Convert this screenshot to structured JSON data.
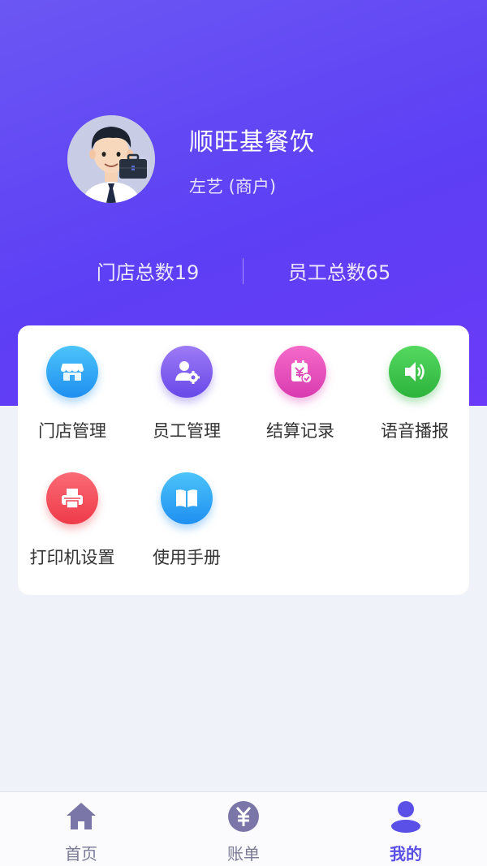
{
  "profile": {
    "shop_name": "顺旺基餐饮",
    "user_line": "左艺 (商户)",
    "avatar_icon": "merchant-avatar"
  },
  "stats": {
    "store_count": "门店总数19",
    "staff_count": "员工总数65"
  },
  "menu": {
    "items": [
      {
        "label": "门店管理",
        "icon": "store-icon"
      },
      {
        "label": "员工管理",
        "icon": "staff-settings-icon"
      },
      {
        "label": "结算记录",
        "icon": "settlement-record-icon"
      },
      {
        "label": "语音播报",
        "icon": "speaker-icon"
      },
      {
        "label": "打印机设置",
        "icon": "printer-icon"
      },
      {
        "label": "使用手册",
        "icon": "manual-book-icon"
      }
    ]
  },
  "tabbar": {
    "items": [
      {
        "label": "首页",
        "icon": "home-icon"
      },
      {
        "label": "账单",
        "icon": "yuan-bill-icon"
      },
      {
        "label": "我的",
        "icon": "person-icon"
      }
    ],
    "active_index": 2
  },
  "colors": {
    "header_gradient_start": "#6b57f3",
    "header_gradient_end": "#6a3af8",
    "active_tab": "#5a4fe6",
    "inactive_tab": "#7a7a96"
  }
}
